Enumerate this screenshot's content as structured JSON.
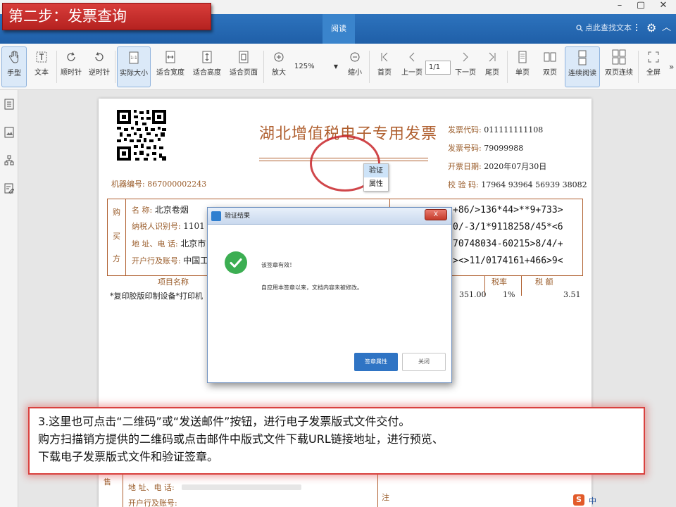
{
  "step_banner": "第二步：发票查询",
  "window_controls": {
    "minimize": "–",
    "restore": "▢",
    "close": "✕"
  },
  "nav": {
    "active_tab": "阅读",
    "search_label": "点此查找文本"
  },
  "toolbar": {
    "hand": "手型",
    "text": "文本",
    "rotate_cw": "顺时针",
    "rotate_ccw": "逆时针",
    "actual_size": "实际大小",
    "fit_width": "适合宽度",
    "fit_height": "适合高度",
    "fit_page": "适合页面",
    "zoom_in": "放大",
    "zoom_value": "125%",
    "zoom_out": "缩小",
    "first_page": "首页",
    "prev_page": "上一页",
    "page_value": "1/1",
    "next_page": "下一页",
    "last_page": "尾页",
    "single_page": "单页",
    "double_page": "双页",
    "continuous": "连续阅读",
    "double_continuous": "双页连续",
    "fullscreen": "全屏"
  },
  "invoice": {
    "title": "湖北增值税电子专用发票",
    "machine_no_label": "机器编号:",
    "machine_no": "867000002243",
    "code_label": "发票代码:",
    "code": "011111111108",
    "number_label": "发票号码:",
    "number": "79099988",
    "date_label": "开票日期:",
    "date": "2020年07月30日",
    "check_label": "校 验 码:",
    "check_code": "17964 93964 56939 38082",
    "buyer_side": [
      "购",
      "买",
      "方"
    ],
    "buyer_name_label": "名      称:",
    "buyer_name": "北京卷烟",
    "taxid_label": "纳税人识别号:",
    "taxid": "1101",
    "addr_label": "地 址、电 话:",
    "addr": "北京市",
    "bank_label": "开户行及账号:",
    "bank": "中国工",
    "cipher": [
      "+86/>136*44>**9+733>",
      "0/-3/1*9118258/45*<6",
      "70748034-60215>8/4/+",
      "><>11/0174161+466>9<"
    ],
    "item_header": "项目名称",
    "item_name": "*复印胶版印制设备*打印机",
    "amount": "351.00",
    "rate_header": "税率",
    "rate": "1%",
    "tax_header": "税  额",
    "tax": "3.51",
    "seller_addr_label": "地 址、电 话:",
    "seller_bank_label": "开户行及账号:",
    "seller_side": "售",
    "note_label": "注"
  },
  "context_menu": [
    "验证",
    "属性"
  ],
  "dialog": {
    "title": "验证结果",
    "close": "X",
    "message1": "该签章有效！",
    "message2": "自应用本签章以来，文档内容未被修改。",
    "btn_props": "签章属性",
    "btn_close": "关闭"
  },
  "callout": {
    "line1": "3.这里也可点击“二维码”或“发送邮件”按钮，进行电子发票版式文件交付。",
    "line2": "购方扫描销方提供的二维码或点击邮件中版式文件下载URL链接地址，进行预览、",
    "line3": "下载电子发票版式文件和验证签章。"
  },
  "ime": {
    "logo": "S",
    "label": "中"
  }
}
